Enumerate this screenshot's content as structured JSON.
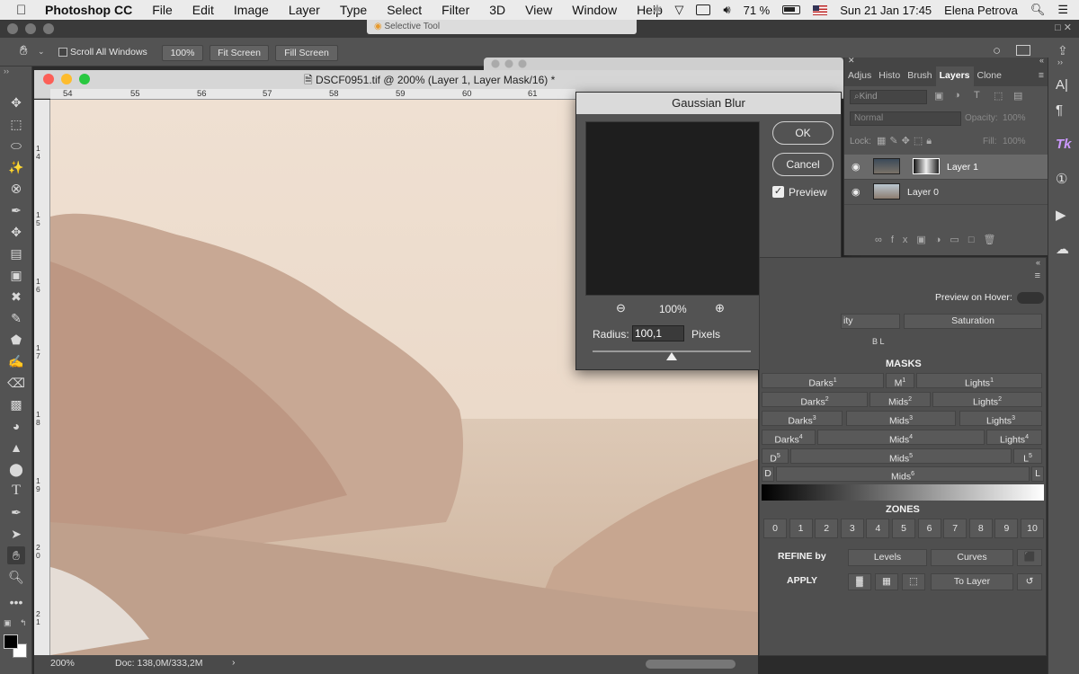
{
  "menubar": {
    "app_name": "Photoshop CC",
    "items": [
      "File",
      "Edit",
      "Image",
      "Layer",
      "Type",
      "Select",
      "Filter",
      "3D",
      "View",
      "Window",
      "Help"
    ],
    "battery": "71 %",
    "datetime": "Sun 21 Jan  17:45",
    "user": "Elena Petrova"
  },
  "titlestrip": {
    "selective_tool": "Selective Tool"
  },
  "options": {
    "scroll_all_windows": "Scroll All Windows",
    "zoom": "100%",
    "fit_screen": "Fit Screen",
    "fill_screen": "Fill Screen"
  },
  "document": {
    "title": "DSCF0951.tif @ 200% (Layer 1, Layer Mask/16) *",
    "ruler_ticks": [
      "54",
      "55",
      "56",
      "57",
      "58",
      "59",
      "60",
      "61"
    ],
    "vruler_ticks": [
      "1\n4",
      "1\n5",
      "1\n6",
      "1\n7",
      "1\n8",
      "1\n9",
      "2\n0",
      "2\n1"
    ],
    "status_zoom": "200%",
    "status_doc": "Doc: 138,0M/333,2M"
  },
  "dialog": {
    "title": "Gaussian Blur",
    "ok": "OK",
    "cancel": "Cancel",
    "preview": "Preview",
    "preview_zoom": "100%",
    "radius_label": "Radius:",
    "radius_value": "100,1",
    "units": "Pixels",
    "slider_fraction": 0.5
  },
  "layers_panel": {
    "tabs": [
      "Adjus",
      "Histo",
      "Brush",
      "Layers",
      "Clone"
    ],
    "kind": "Kind",
    "blend": "Normal",
    "opacity_label": "Opacity:",
    "opacity_value": "100%",
    "lock_label": "Lock:",
    "fill_label": "Fill:",
    "fill_value": "100%",
    "layers": [
      "Layer 1",
      "Layer 0"
    ]
  },
  "lum_panel": {
    "preview_on_hover": "Preview on Hover:",
    "ity": "ity",
    "saturation": "Saturation",
    "bl": "B L",
    "masks_title": "MASKS",
    "zones_title": "ZONES",
    "refine_by": "REFINE by",
    "levels": "Levels",
    "curves": "Curves",
    "apply": "APPLY",
    "to_layer": "To Layer",
    "zones": [
      "0",
      "1",
      "2",
      "3",
      "4",
      "5",
      "6",
      "7",
      "8",
      "9",
      "10"
    ],
    "d_label": "D",
    "l_label": "L",
    "sup": [
      "1",
      "2",
      "3",
      "4",
      "5",
      "6"
    ],
    "darks": "Darks",
    "mids": "Mids",
    "lights": "Lights",
    "m": "M"
  },
  "colors": {
    "accent": "#3f6fb5",
    "panel": "#535353",
    "canvas_tone": "#e9d6c3"
  }
}
